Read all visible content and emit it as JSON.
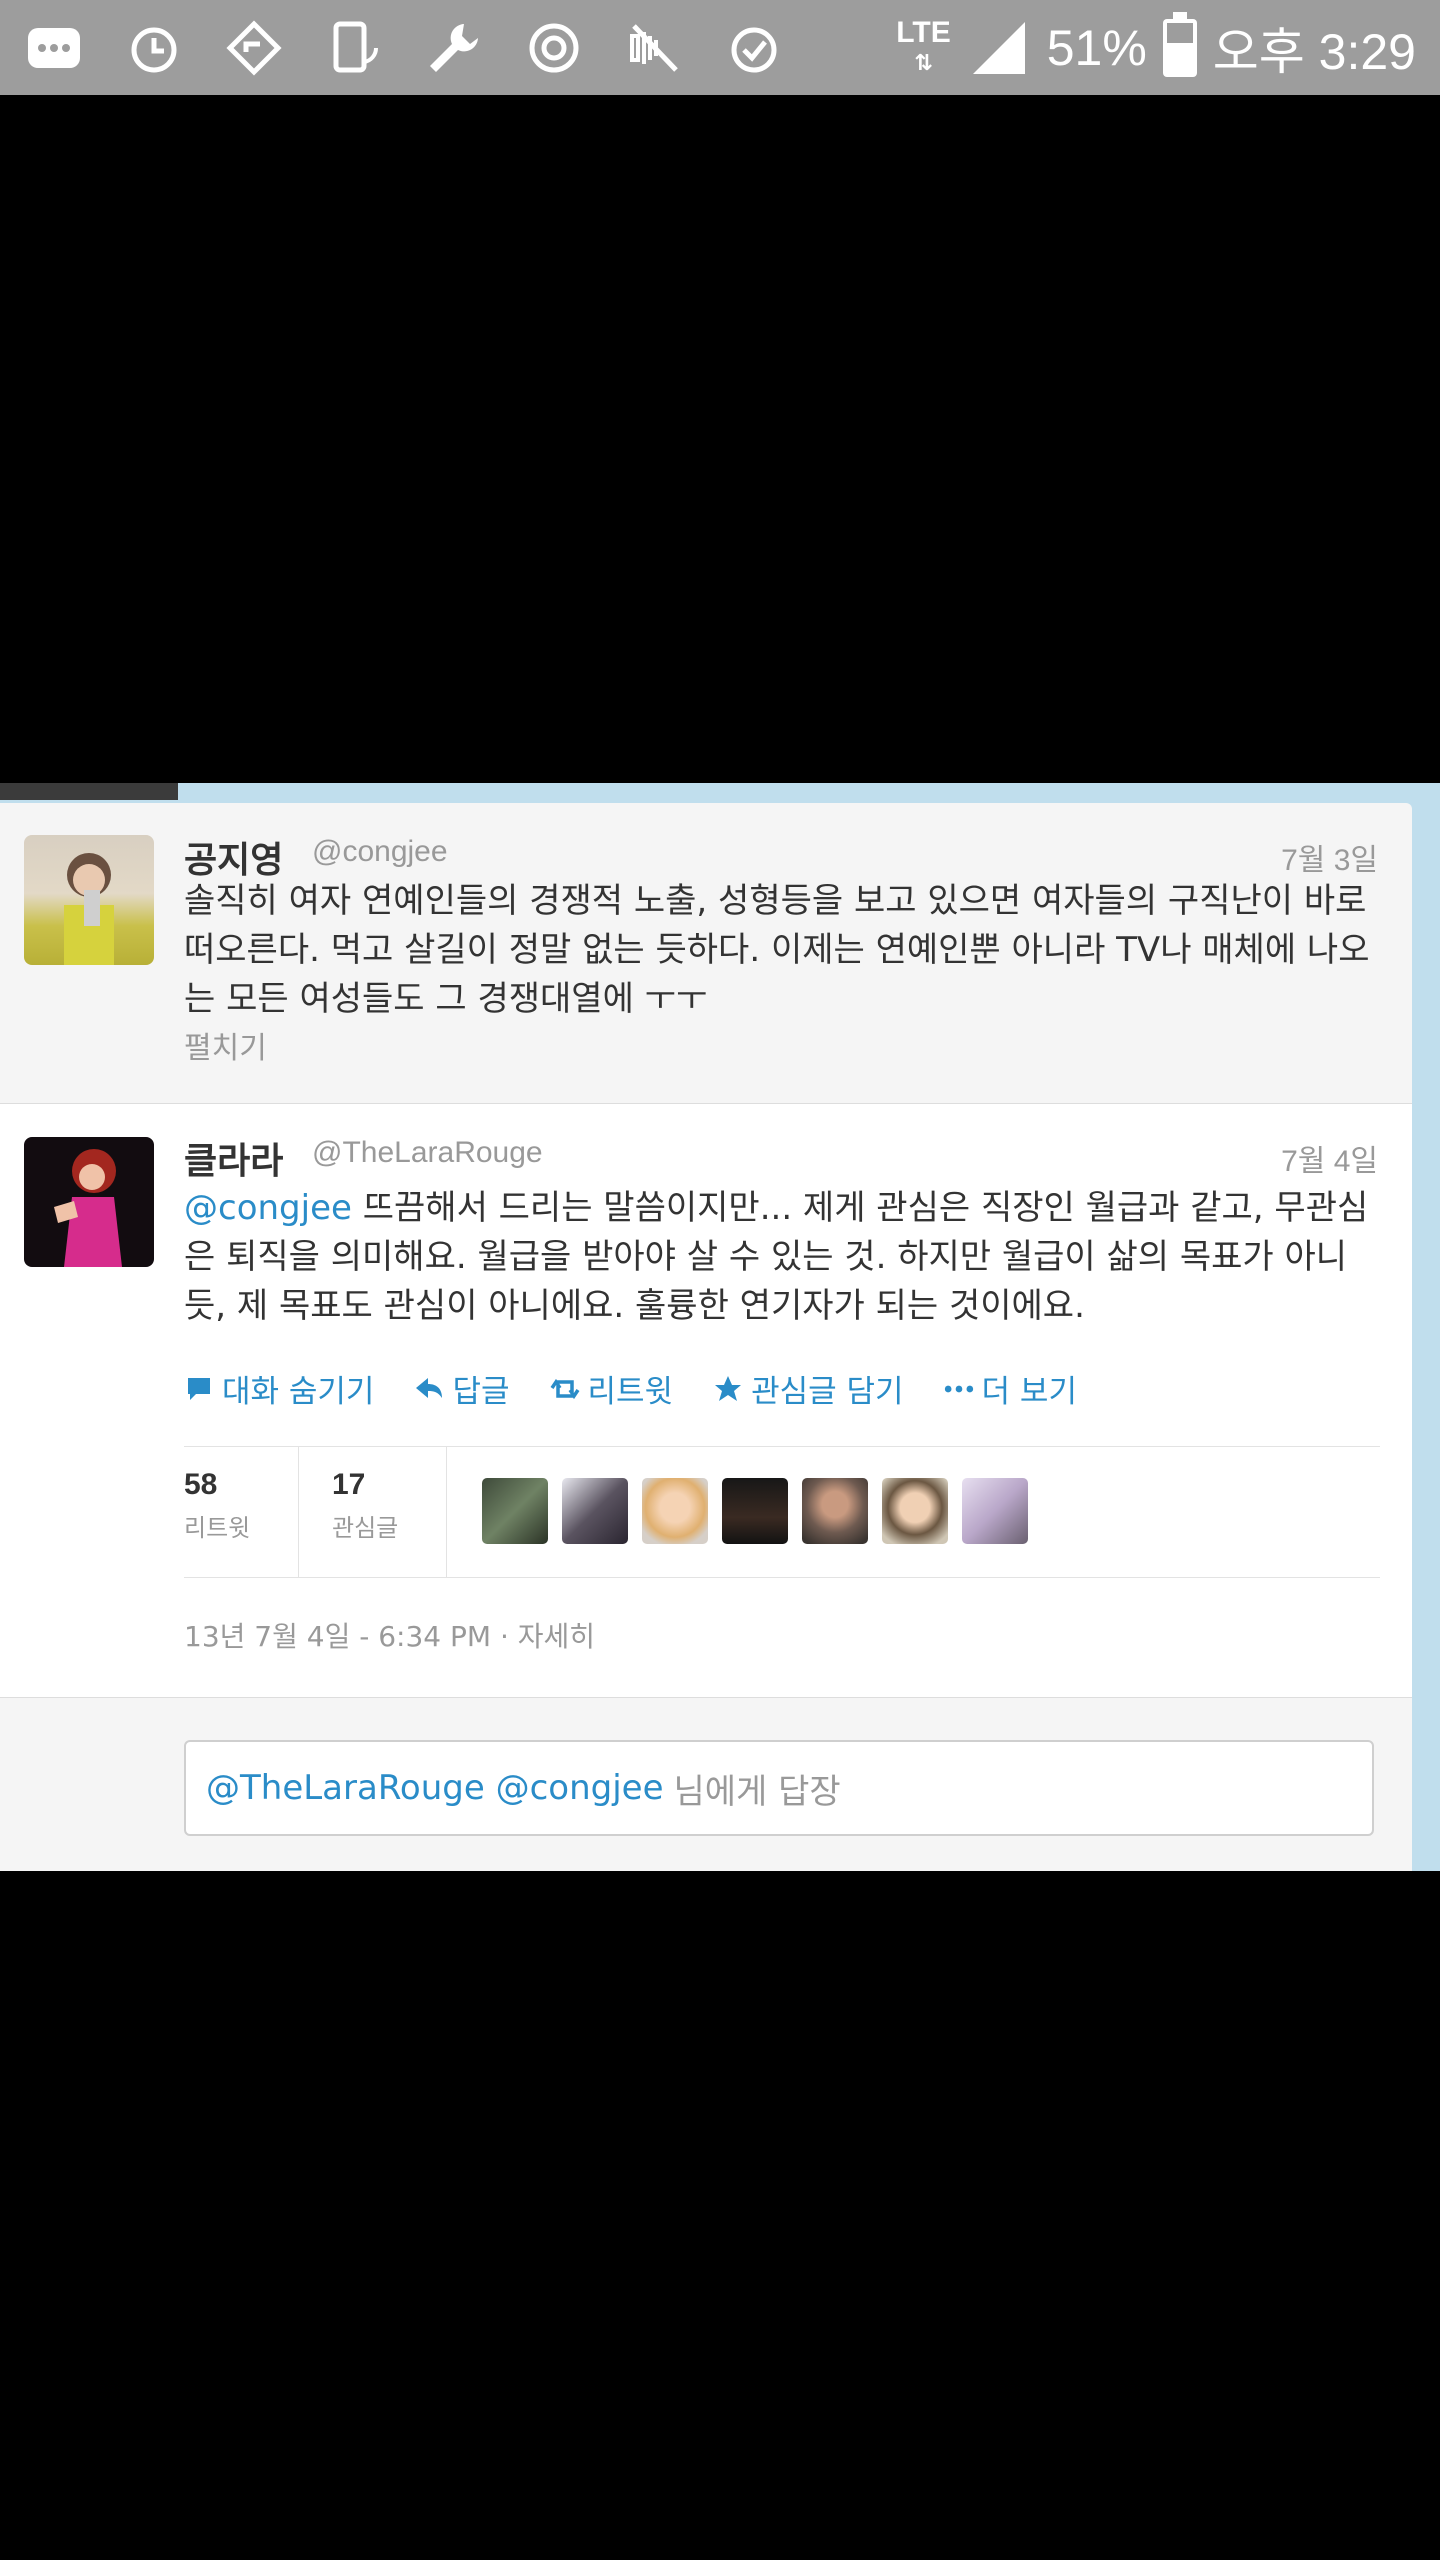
{
  "statusbar": {
    "network": "LTE",
    "battery": "51%",
    "time": "오후 3:29",
    "icons": [
      "chat-icon",
      "alarm-icon",
      "navigation-icon",
      "screen-rotate-icon",
      "wrench-icon",
      "sync-icon",
      "mute-icon",
      "alarm-check-icon",
      "signal-icon",
      "battery-icon"
    ]
  },
  "tweet1": {
    "name": "공지영",
    "handle": "@congjee",
    "date": "7월 3일",
    "text": "솔직히 여자 연예인들의 경쟁적 노출, 성형등을 보고 있으면 여자들의 구직난이 바로 떠오른다. 먹고 살길이 정말 없는 듯하다. 이제는 연예인뿐 아니라 TV나 매체에 나오는 모든 여성들도 그 경쟁대열에 ㅜㅜ",
    "expand": "펼치기"
  },
  "tweet2": {
    "name": "클라라",
    "handle": "@TheLaraRouge",
    "date": "7월 4일",
    "mention": "@congjee",
    "text": " 뜨끔해서 드리는 말씀이지만... 제게 관심은 직장인 월급과 같고, 무관심은 퇴직을 의미해요. 월급을 받아야 살 수 있는 것. 하지만 월급이 삶의 목표가 아니듯, 제 목표도 관심이 아니에요. 훌륭한 연기자가 되는 것이에요.",
    "actions": {
      "hide": "대화 숨기기",
      "reply": "답글",
      "retweet": "리트윗",
      "favorite": "관심글 담기",
      "more": "더 보기"
    },
    "stats": {
      "retweets": "58",
      "retweets_label": "리트윗",
      "favorites": "17",
      "favorites_label": "관심글"
    },
    "timestamp": "13년 7월 4일 - 6:34 PM · 자세히"
  },
  "reply": {
    "mentions": "@TheLaraRouge @congjee",
    "placeholder": "님에게 답장"
  },
  "colors": {
    "link": "#2a8cc8",
    "statusbar": "#9d9d9d",
    "frame": "#c0deed"
  }
}
